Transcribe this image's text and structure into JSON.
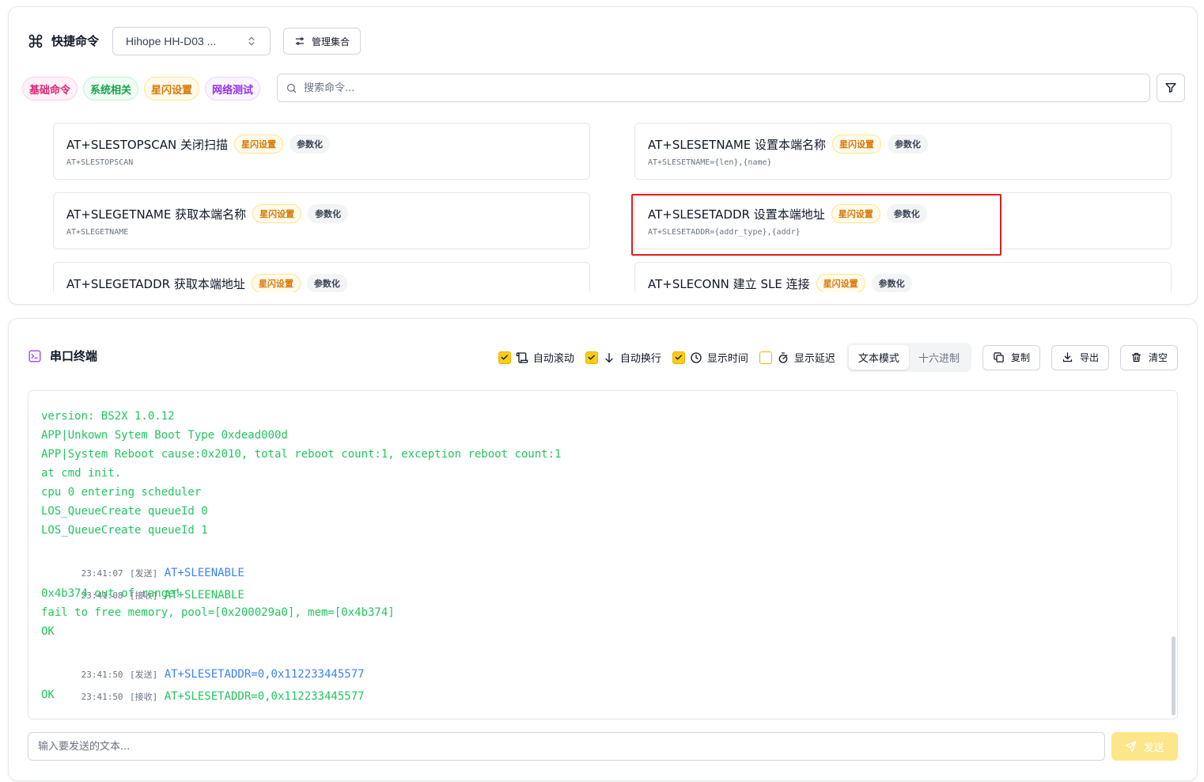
{
  "quick_commands": {
    "title": "快捷命令",
    "set_select_value": "Hihope HH-D03 ...",
    "manage_label": "管理集合",
    "chips": [
      {
        "label": "基础命令",
        "color": "pink"
      },
      {
        "label": "系统相关",
        "color": "green"
      },
      {
        "label": "星闪设置",
        "color": "amber"
      },
      {
        "label": "网络测试",
        "color": "purple"
      }
    ],
    "search_placeholder": "搜索命令...",
    "cards": [
      {
        "title": "AT+SLESTOPSCAN 关闭扫描",
        "tag": "星闪设置",
        "badge": "参数化",
        "cmd": "AT+SLESTOPSCAN"
      },
      {
        "title": "AT+SLESETNAME 设置本端名称",
        "tag": "星闪设置",
        "badge": "参数化",
        "cmd": "AT+SLESETNAME={len},{name}"
      },
      {
        "title": "AT+SLEGETNAME 获取本端名称",
        "tag": "星闪设置",
        "badge": "参数化",
        "cmd": "AT+SLEGETNAME"
      },
      {
        "title": "AT+SLESETADDR 设置本端地址",
        "tag": "星闪设置",
        "badge": "参数化",
        "cmd": "AT+SLESETADDR={addr_type},{addr}"
      },
      {
        "title": "AT+SLEGETADDR 获取本端地址",
        "tag": "星闪设置",
        "badge": "参数化",
        "cmd": ""
      },
      {
        "title": "AT+SLECONN 建立 SLE 连接",
        "tag": "星闪设置",
        "badge": "参数化",
        "cmd": ""
      }
    ]
  },
  "terminal": {
    "title": "串口终端",
    "options": [
      {
        "label": "自动滚动",
        "checked": true,
        "icon": "scroll-icon"
      },
      {
        "label": "自动换行",
        "checked": true,
        "icon": "arrow-down-icon"
      },
      {
        "label": "显示时间",
        "checked": true,
        "icon": "clock-icon"
      },
      {
        "label": "显示延迟",
        "checked": false,
        "icon": "timer-icon"
      }
    ],
    "modes": [
      "文本模式",
      "十六进制"
    ],
    "active_mode": "文本模式",
    "copy_label": "复制",
    "export_label": "导出",
    "clear_label": "清空",
    "lines": [
      {
        "type": "plain",
        "text": "version: BS2X 1.0.12"
      },
      {
        "type": "plain",
        "text": "APP|Unkown Sytem Boot Type 0xdead000d"
      },
      {
        "type": "plain",
        "text": "APP|System Reboot cause:0x2010, total reboot count:1, exception reboot count:1"
      },
      {
        "type": "plain",
        "text": "at cmd init."
      },
      {
        "type": "plain",
        "text": "cpu 0 entering scheduler"
      },
      {
        "type": "plain",
        "text": "LOS_QueueCreate queueId 0"
      },
      {
        "type": "plain",
        "text": "LOS_QueueCreate queueId 1"
      },
      {
        "type": "tx",
        "time": "23:41:07",
        "dir": "[发送]",
        "text": "AT+SLEENABLE",
        "color": "blue"
      },
      {
        "type": "tx",
        "time": "23:41:08",
        "dir": "[接收]",
        "text": "AT+SLEENABLE",
        "color": "green"
      },
      {
        "type": "plain",
        "text": "0x4b374 out of range!"
      },
      {
        "type": "plain",
        "text": "fail to free memory, pool=[0x200029a0], mem=[0x4b374]"
      },
      {
        "type": "plain",
        "text": "OK"
      },
      {
        "type": "tx",
        "time": "23:41:50",
        "dir": "[发送]",
        "text": "AT+SLESETADDR=0,0x112233445577",
        "color": "blue"
      },
      {
        "type": "tx",
        "time": "23:41:50",
        "dir": "[接收]",
        "text": "AT+SLESETADDR=0,0x112233445577",
        "color": "green"
      },
      {
        "type": "plain",
        "text": "OK"
      }
    ],
    "input_placeholder": "输入要发送的文本...",
    "send_label": "发送"
  },
  "colors": {
    "accent": "#facc15",
    "send_text": "#3b82f6",
    "recv_text": "#22c55e",
    "highlight_box": "#e11d1d"
  }
}
